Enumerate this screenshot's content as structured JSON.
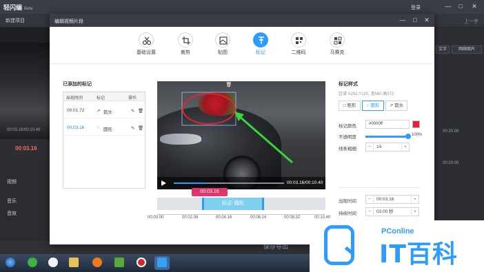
{
  "app": {
    "title": "轻闪编",
    "beta": "Beta",
    "login": "登录",
    "new_project": "新建项目",
    "undo": "上一步",
    "current_time": "00:03.16",
    "left_time": "00:03.16/00:10.40",
    "tracks": {
      "video": "视频",
      "music": "音乐",
      "dub": "音效"
    },
    "right_buttons": {
      "b1": "文字",
      "b2": "网络图片"
    },
    "right_times": [
      "00:20.00",
      "00:20.00"
    ],
    "save_button": "保存导出"
  },
  "modal": {
    "title": "编辑视频片段",
    "tabs": [
      {
        "label": "基础设置",
        "icon": "scissors-icon"
      },
      {
        "label": "裁剪",
        "icon": "crop-icon"
      },
      {
        "label": "贴图",
        "icon": "image-icon"
      },
      {
        "label": "标记",
        "icon": "pin-icon",
        "active": true
      },
      {
        "label": "二维码",
        "icon": "qrcode-icon"
      },
      {
        "label": "马赛克",
        "icon": "mosaic-icon"
      }
    ],
    "marks": {
      "title": "已添加的标记",
      "headers": {
        "time": "出现时间",
        "mark": "标记",
        "ops": "操作"
      },
      "rows": [
        {
          "time": "00:01.72",
          "mark": "箭头",
          "icon": "arrow-icon"
        },
        {
          "time": "00:03.16",
          "mark": "圆形",
          "icon": "circle-icon",
          "selected": true
        }
      ]
    },
    "preview": {
      "time": "00:03.16/00:10.40",
      "progress": 0.3
    },
    "timeline": {
      "current": "00:03.16",
      "clip_label": "标记: 圆形",
      "ticks": [
        "00:00.00",
        "00:02.08",
        "00:04.16",
        "00:06.24",
        "00:08.32",
        "00:10.40"
      ]
    },
    "style": {
      "title": "标记样式",
      "subtitle": "区域 X292,Y120, 宽560,高372",
      "shapes": [
        {
          "label": "矩形",
          "icon": "square-icon"
        },
        {
          "label": "圆形",
          "icon": "circle-icon",
          "active": true
        },
        {
          "label": "箭头",
          "icon": "arrow-icon"
        }
      ],
      "color_label": "标记颜色",
      "color_value": "#0000ff",
      "swatch_color": "#e8232f",
      "opacity_label": "不透明度",
      "opacity_value": "100%",
      "opacity_fraction": 1.0,
      "border_label": "线条粗细",
      "border_value": "14",
      "appear_label": "出现时间",
      "appear_value": "00:03.16",
      "duration_label": "持续时间",
      "duration_value": "03.00 秒"
    }
  },
  "watermark": {
    "brand": "PConline",
    "big": "IT百科"
  }
}
